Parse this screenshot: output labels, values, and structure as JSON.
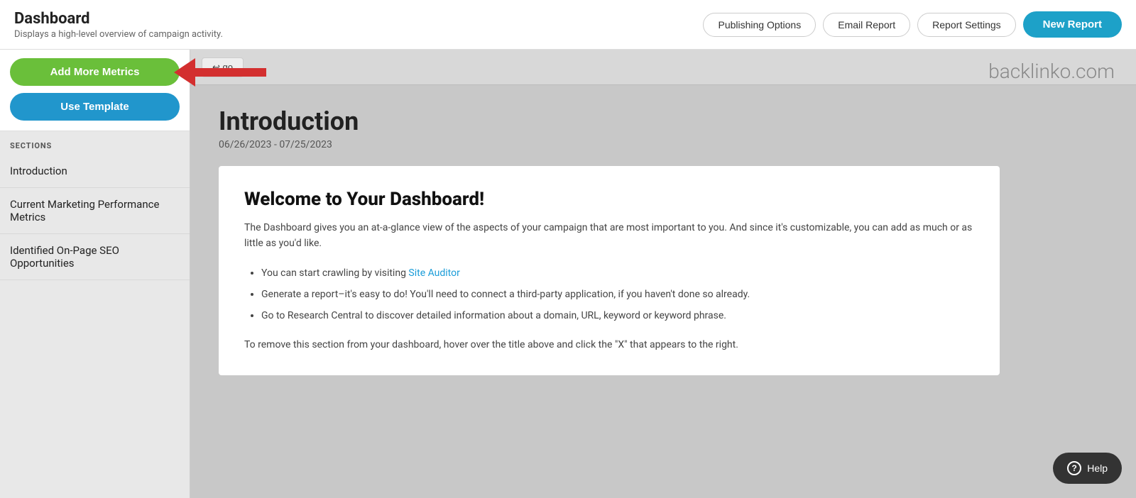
{
  "header": {
    "title": "Dashboard",
    "subtitle": "Displays a high-level overview of campaign activity.",
    "actions": {
      "publishing_options": "Publishing Options",
      "email_report": "Email Report",
      "report_settings": "Report Settings",
      "new_report": "New Report"
    }
  },
  "sidebar": {
    "add_metrics_label": "Add More Metrics",
    "use_template_label": "Use Template",
    "sections_heading": "SECTIONS",
    "nav_items": [
      {
        "label": "Introduction"
      },
      {
        "label": "Current Marketing Performance Metrics"
      },
      {
        "label": "Identified On-Page SEO Opportunities"
      }
    ]
  },
  "toolbar": {
    "undo_label": "↩ go"
  },
  "site": {
    "domain": "backlinko.com"
  },
  "main": {
    "section_title": "Introduction",
    "date_range": "06/26/2023 - 07/25/2023",
    "card": {
      "heading": "Welcome to Your Dashboard!",
      "intro": "The Dashboard gives you an at-a-glance view of the aspects of your campaign that are most important to you. And since it's customizable, you can add as much or as little as you'd like.",
      "list_items": [
        {
          "text": "You can start crawling by visiting ",
          "link": "Site Auditor",
          "link_href": "#"
        },
        {
          "text": "Generate a report–it's easy to do! You'll need to connect a third-party application, if you haven't done so already."
        },
        {
          "text": "Go to Research Central to discover detailed information about a domain, URL, keyword or keyword phrase."
        }
      ],
      "footer": "To remove this section from your dashboard, hover over the title above and click the \"X\" that appears to the right."
    }
  },
  "help": {
    "label": "Help"
  }
}
